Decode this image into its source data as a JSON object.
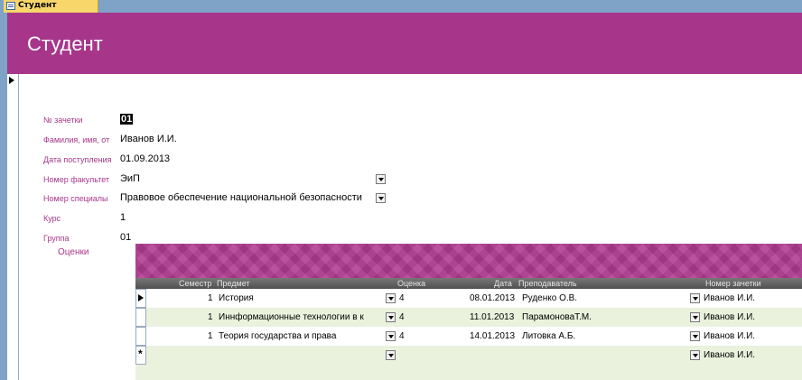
{
  "tab": {
    "label": "Студент"
  },
  "header": {
    "title": "Студент"
  },
  "fields": [
    {
      "label": "№ зачетки",
      "value": "01"
    },
    {
      "label": "Фамилия, имя, от",
      "value": "Иванов И.И."
    },
    {
      "label": "Дата поступления",
      "value": "01.09.2013"
    },
    {
      "label": "Номер факультет",
      "value": "ЭиП"
    },
    {
      "label": "Номер специалы",
      "value": "Правовое обеспечение национальной безопасности"
    },
    {
      "label": "Курс",
      "value": "1"
    },
    {
      "label": "Группа",
      "value": "01"
    }
  ],
  "subform": {
    "label": "Оценки",
    "columns": [
      "Семестр",
      "Предмет",
      "Оценка",
      "Дата",
      "Преподаватель",
      "Номер зачетки"
    ],
    "rows": [
      {
        "semester": "1",
        "subject": "История",
        "grade": "4",
        "date": "08.01.2013",
        "teacher": "Руденко О.В.",
        "record": "Иванов И.И."
      },
      {
        "semester": "1",
        "subject": "Иннформационные технологии в к",
        "grade": "4",
        "date": "11.01.2013",
        "teacher": "ПарамоноваТ.М.",
        "record": "Иванов И.И."
      },
      {
        "semester": "1",
        "subject": "Теория государства и права",
        "grade": "4",
        "date": "14.01.2013",
        "teacher": "Литовка А.Б.",
        "record": "Иванов И.И."
      }
    ],
    "new_row": {
      "record": "Иванов И.И.",
      "marker": "*"
    }
  }
}
